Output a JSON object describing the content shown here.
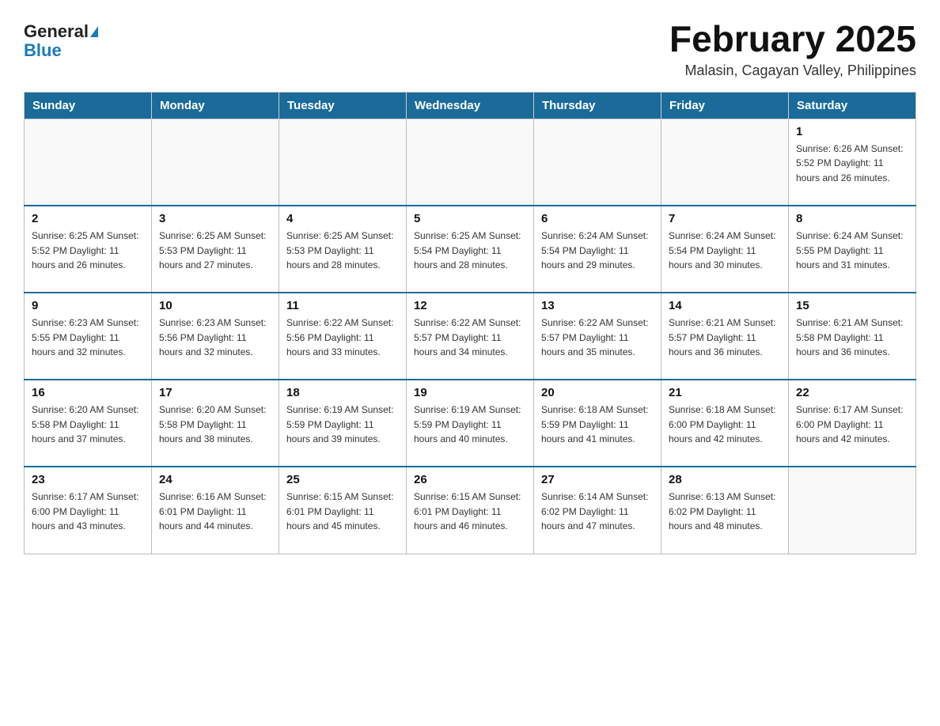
{
  "logo": {
    "general": "General",
    "blue": "Blue"
  },
  "title": "February 2025",
  "subtitle": "Malasin, Cagayan Valley, Philippines",
  "weekdays": [
    "Sunday",
    "Monday",
    "Tuesday",
    "Wednesday",
    "Thursday",
    "Friday",
    "Saturday"
  ],
  "weeks": [
    [
      {
        "day": "",
        "info": ""
      },
      {
        "day": "",
        "info": ""
      },
      {
        "day": "",
        "info": ""
      },
      {
        "day": "",
        "info": ""
      },
      {
        "day": "",
        "info": ""
      },
      {
        "day": "",
        "info": ""
      },
      {
        "day": "1",
        "info": "Sunrise: 6:26 AM\nSunset: 5:52 PM\nDaylight: 11 hours and 26 minutes."
      }
    ],
    [
      {
        "day": "2",
        "info": "Sunrise: 6:25 AM\nSunset: 5:52 PM\nDaylight: 11 hours and 26 minutes."
      },
      {
        "day": "3",
        "info": "Sunrise: 6:25 AM\nSunset: 5:53 PM\nDaylight: 11 hours and 27 minutes."
      },
      {
        "day": "4",
        "info": "Sunrise: 6:25 AM\nSunset: 5:53 PM\nDaylight: 11 hours and 28 minutes."
      },
      {
        "day": "5",
        "info": "Sunrise: 6:25 AM\nSunset: 5:54 PM\nDaylight: 11 hours and 28 minutes."
      },
      {
        "day": "6",
        "info": "Sunrise: 6:24 AM\nSunset: 5:54 PM\nDaylight: 11 hours and 29 minutes."
      },
      {
        "day": "7",
        "info": "Sunrise: 6:24 AM\nSunset: 5:54 PM\nDaylight: 11 hours and 30 minutes."
      },
      {
        "day": "8",
        "info": "Sunrise: 6:24 AM\nSunset: 5:55 PM\nDaylight: 11 hours and 31 minutes."
      }
    ],
    [
      {
        "day": "9",
        "info": "Sunrise: 6:23 AM\nSunset: 5:55 PM\nDaylight: 11 hours and 32 minutes."
      },
      {
        "day": "10",
        "info": "Sunrise: 6:23 AM\nSunset: 5:56 PM\nDaylight: 11 hours and 32 minutes."
      },
      {
        "day": "11",
        "info": "Sunrise: 6:22 AM\nSunset: 5:56 PM\nDaylight: 11 hours and 33 minutes."
      },
      {
        "day": "12",
        "info": "Sunrise: 6:22 AM\nSunset: 5:57 PM\nDaylight: 11 hours and 34 minutes."
      },
      {
        "day": "13",
        "info": "Sunrise: 6:22 AM\nSunset: 5:57 PM\nDaylight: 11 hours and 35 minutes."
      },
      {
        "day": "14",
        "info": "Sunrise: 6:21 AM\nSunset: 5:57 PM\nDaylight: 11 hours and 36 minutes."
      },
      {
        "day": "15",
        "info": "Sunrise: 6:21 AM\nSunset: 5:58 PM\nDaylight: 11 hours and 36 minutes."
      }
    ],
    [
      {
        "day": "16",
        "info": "Sunrise: 6:20 AM\nSunset: 5:58 PM\nDaylight: 11 hours and 37 minutes."
      },
      {
        "day": "17",
        "info": "Sunrise: 6:20 AM\nSunset: 5:58 PM\nDaylight: 11 hours and 38 minutes."
      },
      {
        "day": "18",
        "info": "Sunrise: 6:19 AM\nSunset: 5:59 PM\nDaylight: 11 hours and 39 minutes."
      },
      {
        "day": "19",
        "info": "Sunrise: 6:19 AM\nSunset: 5:59 PM\nDaylight: 11 hours and 40 minutes."
      },
      {
        "day": "20",
        "info": "Sunrise: 6:18 AM\nSunset: 5:59 PM\nDaylight: 11 hours and 41 minutes."
      },
      {
        "day": "21",
        "info": "Sunrise: 6:18 AM\nSunset: 6:00 PM\nDaylight: 11 hours and 42 minutes."
      },
      {
        "day": "22",
        "info": "Sunrise: 6:17 AM\nSunset: 6:00 PM\nDaylight: 11 hours and 42 minutes."
      }
    ],
    [
      {
        "day": "23",
        "info": "Sunrise: 6:17 AM\nSunset: 6:00 PM\nDaylight: 11 hours and 43 minutes."
      },
      {
        "day": "24",
        "info": "Sunrise: 6:16 AM\nSunset: 6:01 PM\nDaylight: 11 hours and 44 minutes."
      },
      {
        "day": "25",
        "info": "Sunrise: 6:15 AM\nSunset: 6:01 PM\nDaylight: 11 hours and 45 minutes."
      },
      {
        "day": "26",
        "info": "Sunrise: 6:15 AM\nSunset: 6:01 PM\nDaylight: 11 hours and 46 minutes."
      },
      {
        "day": "27",
        "info": "Sunrise: 6:14 AM\nSunset: 6:02 PM\nDaylight: 11 hours and 47 minutes."
      },
      {
        "day": "28",
        "info": "Sunrise: 6:13 AM\nSunset: 6:02 PM\nDaylight: 11 hours and 48 minutes."
      },
      {
        "day": "",
        "info": ""
      }
    ]
  ]
}
